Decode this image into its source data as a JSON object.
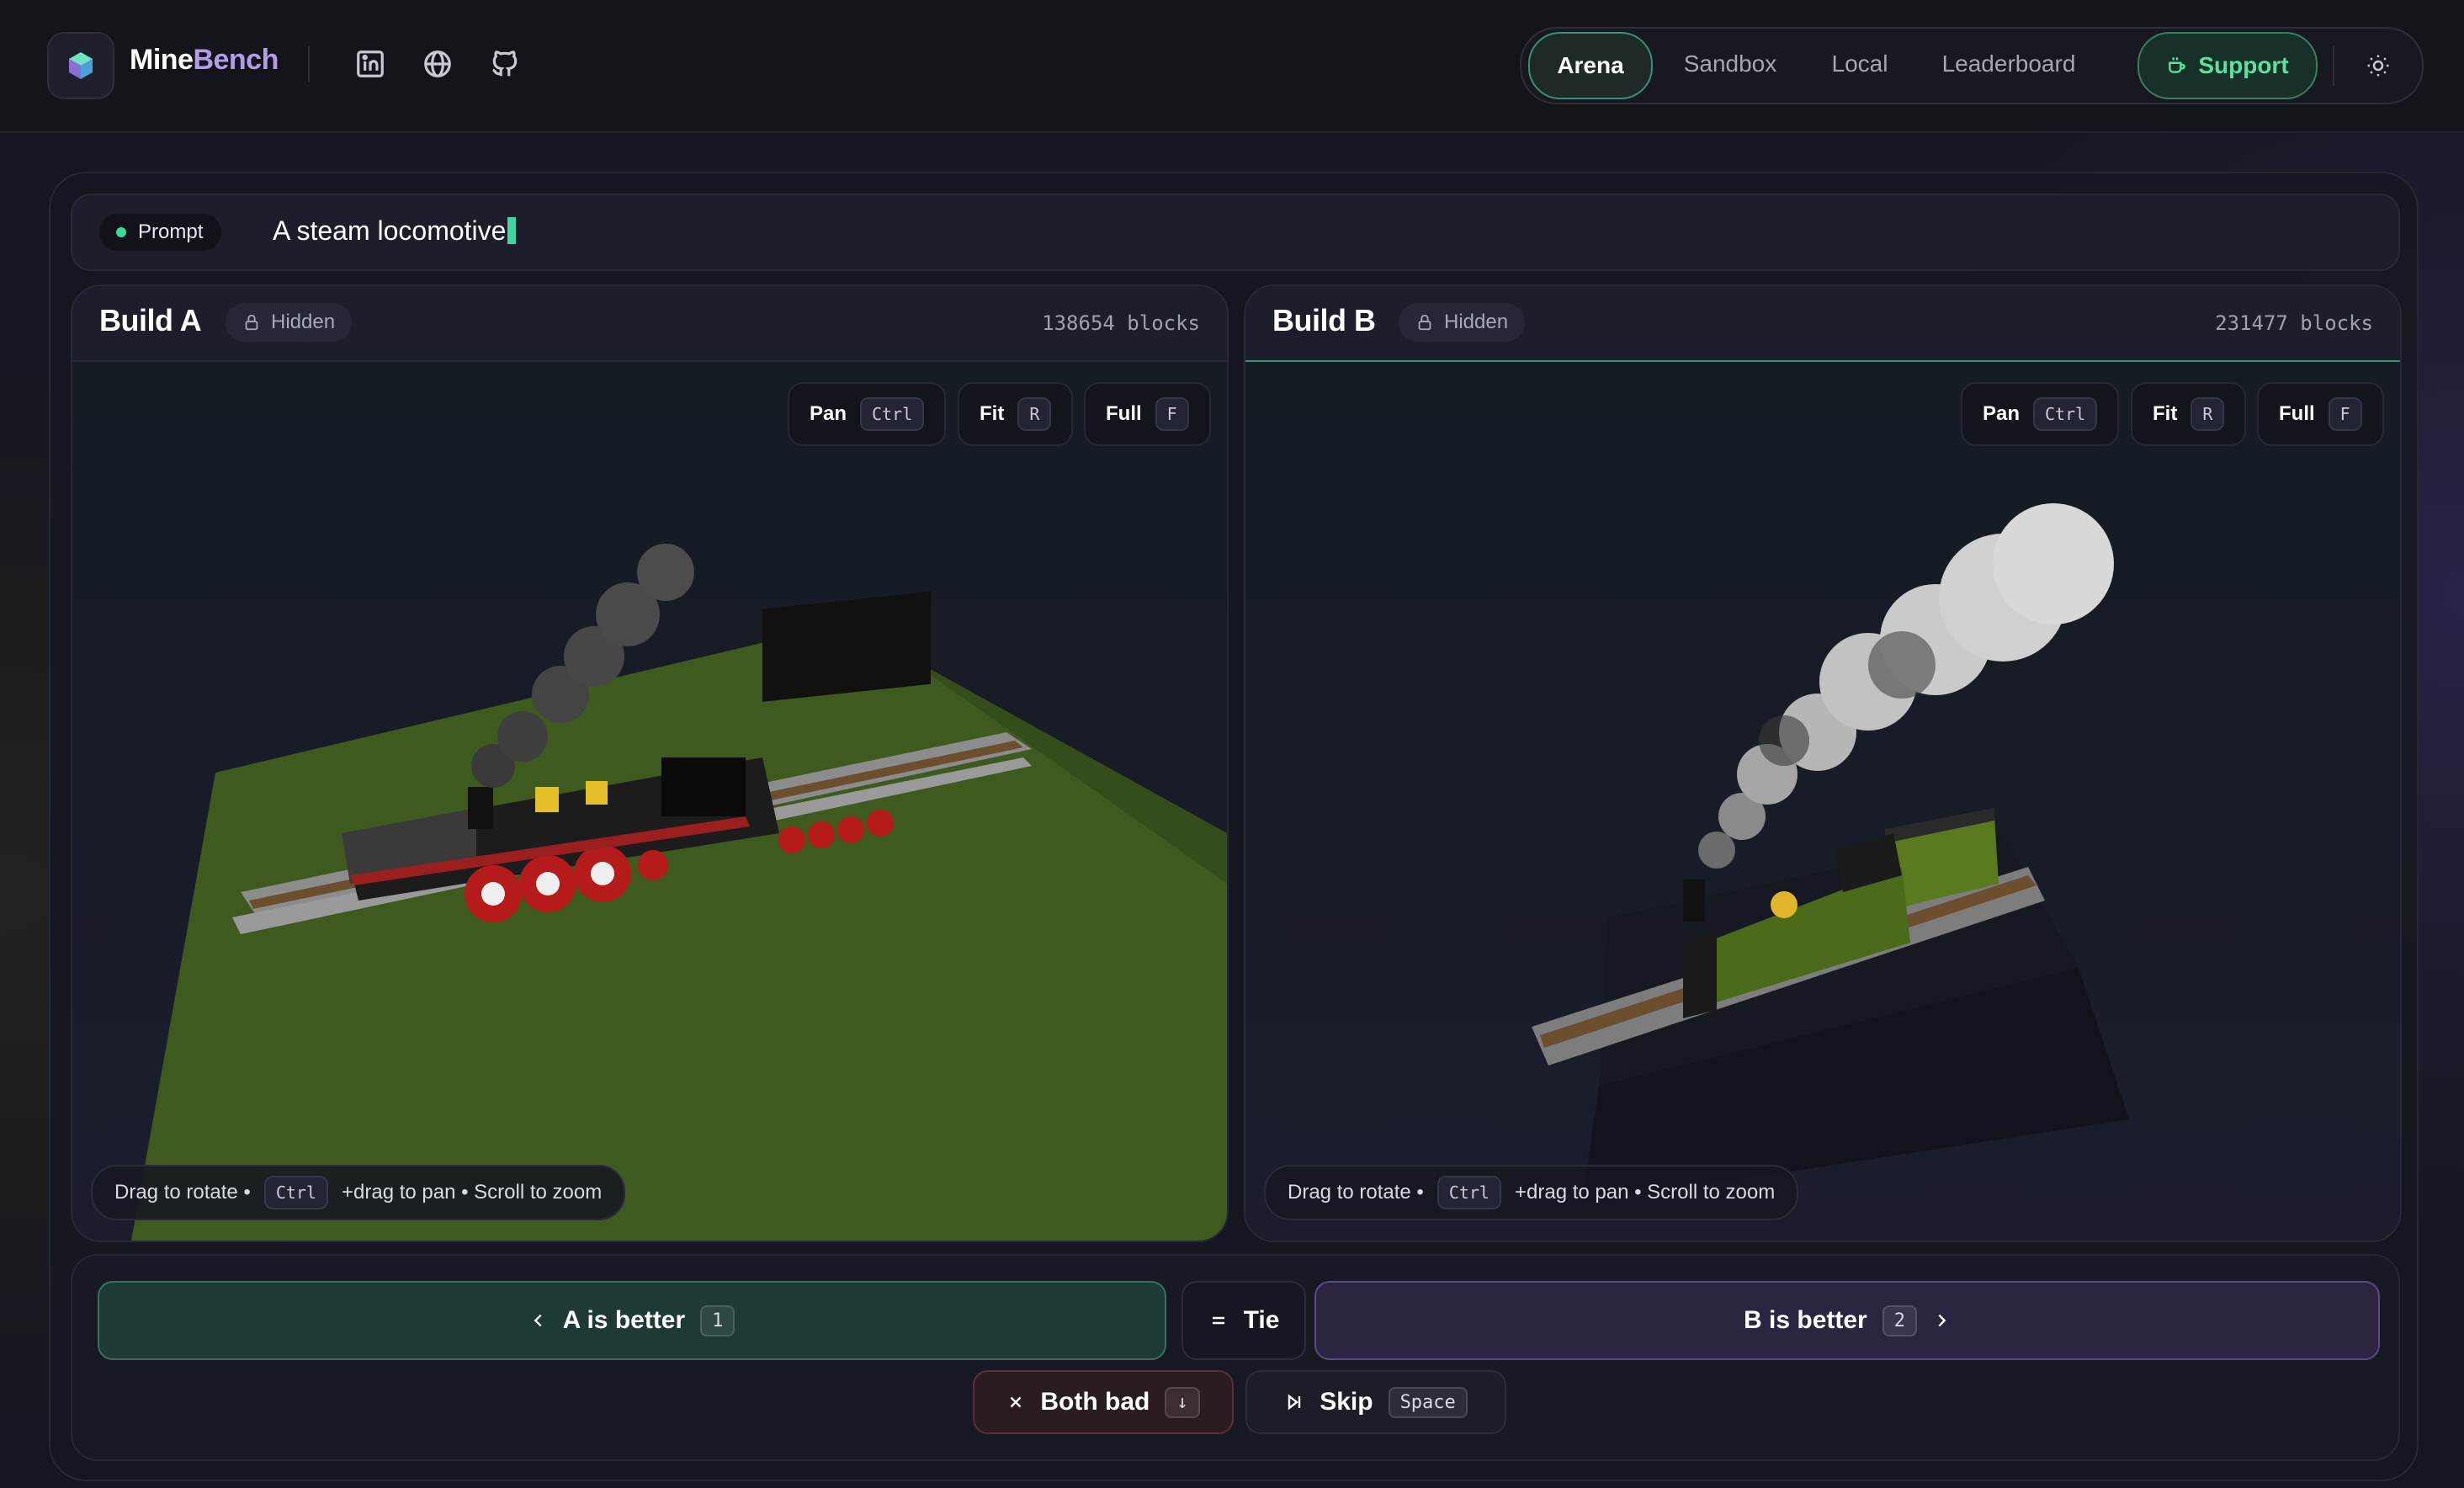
{
  "app": {
    "brand_part1": "Mine",
    "brand_part2": "Bench",
    "accent_color": "#3fd6a0",
    "brand_purple": "#b59ce6"
  },
  "header": {
    "social_icons": [
      "linkedin-icon",
      "globe-icon",
      "github-icon"
    ],
    "nav": {
      "arena": "Arena",
      "sandbox": "Sandbox",
      "local": "Local",
      "leaderboard": "Leaderboard",
      "support": "Support"
    },
    "active_tab": "Arena"
  },
  "prompt": {
    "label": "Prompt",
    "text": "A steam locomotive"
  },
  "build_a": {
    "title": "Build A",
    "visibility": "Hidden",
    "blocks": "138654 blocks",
    "controls": [
      {
        "label": "Pan",
        "key": "Ctrl"
      },
      {
        "label": "Fit",
        "key": "R"
      },
      {
        "label": "Full",
        "key": "F"
      }
    ],
    "hint": {
      "part1": "Drag to rotate •",
      "key": "Ctrl",
      "part2": "+drag to pan • Scroll to zoom"
    }
  },
  "build_b": {
    "title": "Build B",
    "visibility": "Hidden",
    "blocks": "231477 blocks",
    "controls": [
      {
        "label": "Pan",
        "key": "Ctrl"
      },
      {
        "label": "Fit",
        "key": "R"
      },
      {
        "label": "Full",
        "key": "F"
      }
    ],
    "hint": {
      "part1": "Drag to rotate •",
      "key": "Ctrl",
      "part2": "+drag to pan • Scroll to zoom"
    }
  },
  "voting": {
    "a_better": "A is better",
    "a_key": "1",
    "tie": "Tie",
    "b_better": "B is better",
    "b_key": "2",
    "both_bad": "Both bad",
    "both_bad_key": "↓",
    "skip": "Skip",
    "skip_key": "Space"
  }
}
